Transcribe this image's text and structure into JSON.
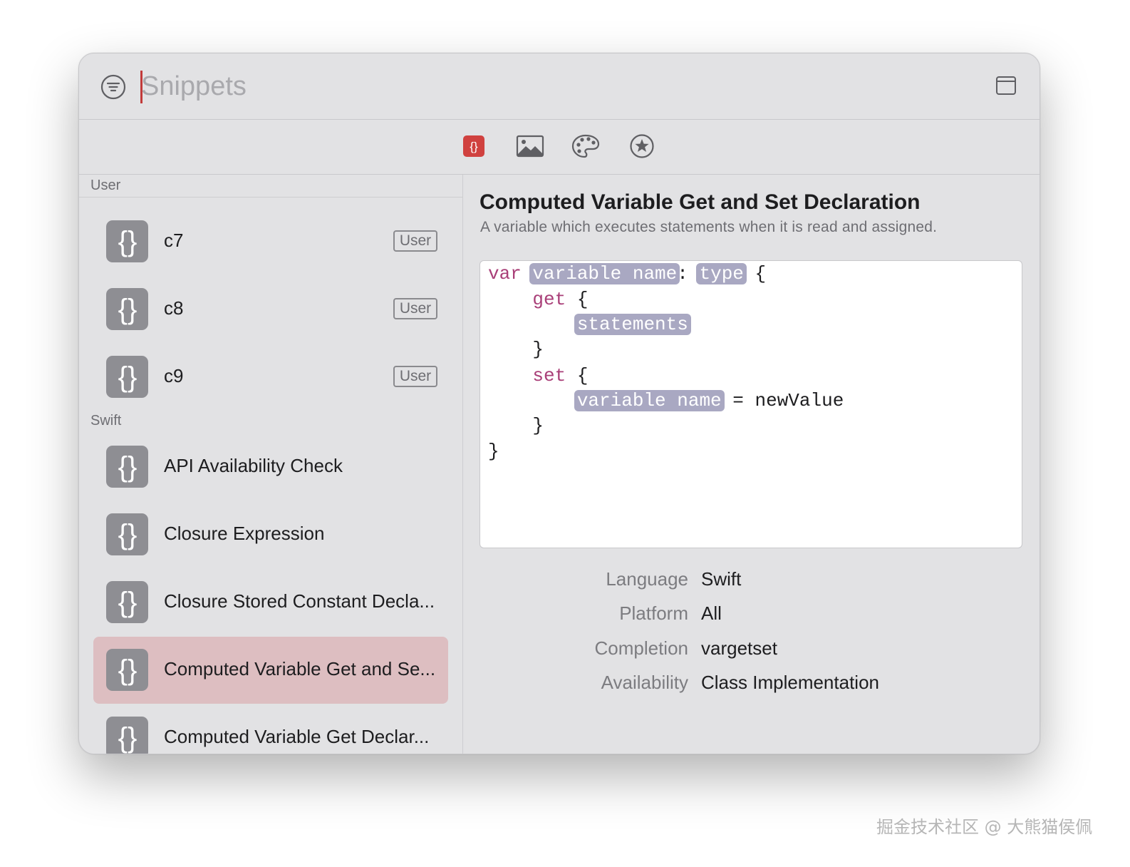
{
  "search": {
    "placeholder": "Snippets"
  },
  "tabs": [
    {
      "name": "code-snippets",
      "active": true
    },
    {
      "name": "media",
      "active": false
    },
    {
      "name": "colors",
      "active": false
    },
    {
      "name": "symbols",
      "active": false
    }
  ],
  "sidebar": {
    "sections": [
      {
        "header": "User",
        "items": [
          {
            "label": "c7",
            "badge": "User"
          },
          {
            "label": "c8",
            "badge": "User"
          },
          {
            "label": "c9",
            "badge": "User"
          }
        ]
      },
      {
        "header": "Swift",
        "items": [
          {
            "label": "API Availability Check"
          },
          {
            "label": "Closure Expression"
          },
          {
            "label": "Closure Stored Constant Decla..."
          },
          {
            "label": "Computed Variable Get and Se...",
            "selected": true
          },
          {
            "label": "Computed Variable Get Declar..."
          }
        ]
      }
    ]
  },
  "detail": {
    "title": "Computed Variable Get and Set Declaration",
    "summary": "A variable which executes statements when it is read and assigned.",
    "code": {
      "var": "var",
      "variable_name": "variable name",
      "colon": ":",
      "type": "type",
      "open_brace": "{",
      "get": "get",
      "statements": "statements",
      "close_brace": "}",
      "set": "set",
      "assign_new_value": "= newValue"
    },
    "meta": [
      {
        "key": "Language",
        "value": "Swift"
      },
      {
        "key": "Platform",
        "value": "All"
      },
      {
        "key": "Completion",
        "value": "vargetset"
      },
      {
        "key": "Availability",
        "value": "Class Implementation"
      }
    ]
  },
  "watermark": "掘金技术社区 @ 大熊猫侯佩",
  "colors": {
    "accent": "#d0413f",
    "selection": "#ddbec1",
    "keyword": "#a93f78",
    "placeholder_token": "#a9a8c2"
  }
}
